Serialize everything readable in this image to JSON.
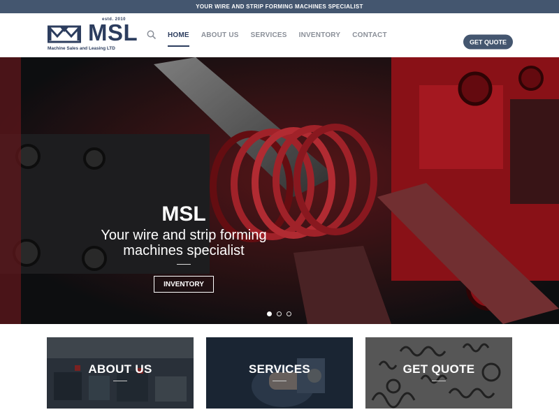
{
  "topbar": {
    "text": "YOUR WIRE AND STRIP FORMING MACHINES SPECIALIST"
  },
  "logo": {
    "estd": "estd. 2010",
    "name": "MSL",
    "tagline": "Machine Sales and Leasing LTD"
  },
  "nav": {
    "items": [
      {
        "label": "HOME",
        "active": true
      },
      {
        "label": "ABOUT US"
      },
      {
        "label": "SERVICES"
      },
      {
        "label": "INVENTORY"
      },
      {
        "label": "CONTACT"
      }
    ],
    "cta": "GET QUOTE"
  },
  "hero": {
    "title": "MSL",
    "subtitle_line1": "Your wire and strip forming",
    "subtitle_line2": "machines specialist",
    "button": "INVENTORY",
    "slides": 3,
    "active_slide": 1
  },
  "cards": [
    {
      "label": "ABOUT US"
    },
    {
      "label": "SERVICES"
    },
    {
      "label": "GET QUOTE"
    }
  ],
  "colors": {
    "brand": "#2c3d5e",
    "topbar": "#44566f",
    "accent_red": "#c81e28"
  }
}
